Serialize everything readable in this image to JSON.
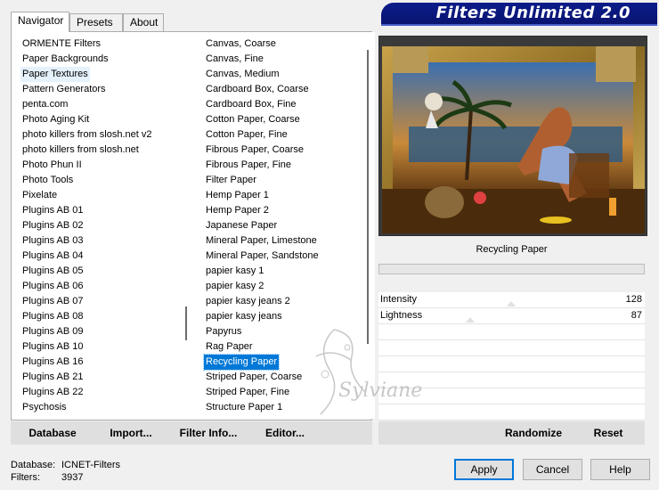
{
  "tabs": [
    "Navigator",
    "Presets",
    "About"
  ],
  "app_title": "Filters Unlimited 2.0",
  "categories": [
    "ORMENTE Filters",
    "Paper Backgrounds",
    "Paper Textures",
    "Pattern Generators",
    "penta.com",
    "Photo Aging Kit",
    "photo killers from slosh.net v2",
    "photo killers from slosh.net",
    "Photo Phun II",
    "Photo Tools",
    "Pixelate",
    "Plugins AB 01",
    "Plugins AB 02",
    "Plugins AB 03",
    "Plugins AB 04",
    "Plugins AB 05",
    "Plugins AB 06",
    "Plugins AB 07",
    "Plugins AB 08",
    "Plugins AB 09",
    "Plugins AB 10",
    "Plugins AB 16",
    "Plugins AB 21",
    "Plugins AB 22",
    "Psychosis"
  ],
  "selected_category": "Paper Textures",
  "filters": [
    "Canvas, Coarse",
    "Canvas, Fine",
    "Canvas, Medium",
    "Cardboard Box, Coarse",
    "Cardboard Box, Fine",
    "Cotton Paper, Coarse",
    "Cotton Paper, Fine",
    "Fibrous Paper, Coarse",
    "Fibrous Paper, Fine",
    "Filter Paper",
    "Hemp Paper 1",
    "Hemp Paper 2",
    "Japanese Paper",
    "Mineral Paper, Limestone",
    "Mineral Paper, Sandstone",
    "papier kasy 1",
    "papier kasy 2",
    "papier kasy jeans 2",
    "papier kasy jeans",
    "Papyrus",
    "Rag Paper",
    "Recycling Paper",
    "Striped Paper, Coarse",
    "Striped Paper, Fine",
    "Structure Paper 1"
  ],
  "selected_filter": "Recycling Paper",
  "buttons": {
    "database": "Database",
    "import": "Import...",
    "filter_info": "Filter Info...",
    "editor": "Editor...",
    "randomize": "Randomize",
    "reset": "Reset",
    "apply": "Apply",
    "cancel": "Cancel",
    "help": "Help"
  },
  "current_filter_name": "Recycling Paper",
  "params": [
    {
      "label": "Intensity",
      "value": "128"
    },
    {
      "label": "Lightness",
      "value": "87"
    }
  ],
  "footer": {
    "database_label": "Database:",
    "database_value": "ICNET-Filters",
    "filters_label": "Filters:",
    "filters_value": "3937"
  },
  "watermark": "Sylviane",
  "colors": {
    "banner": "#0b1c8a",
    "selection": "#0078d7"
  }
}
